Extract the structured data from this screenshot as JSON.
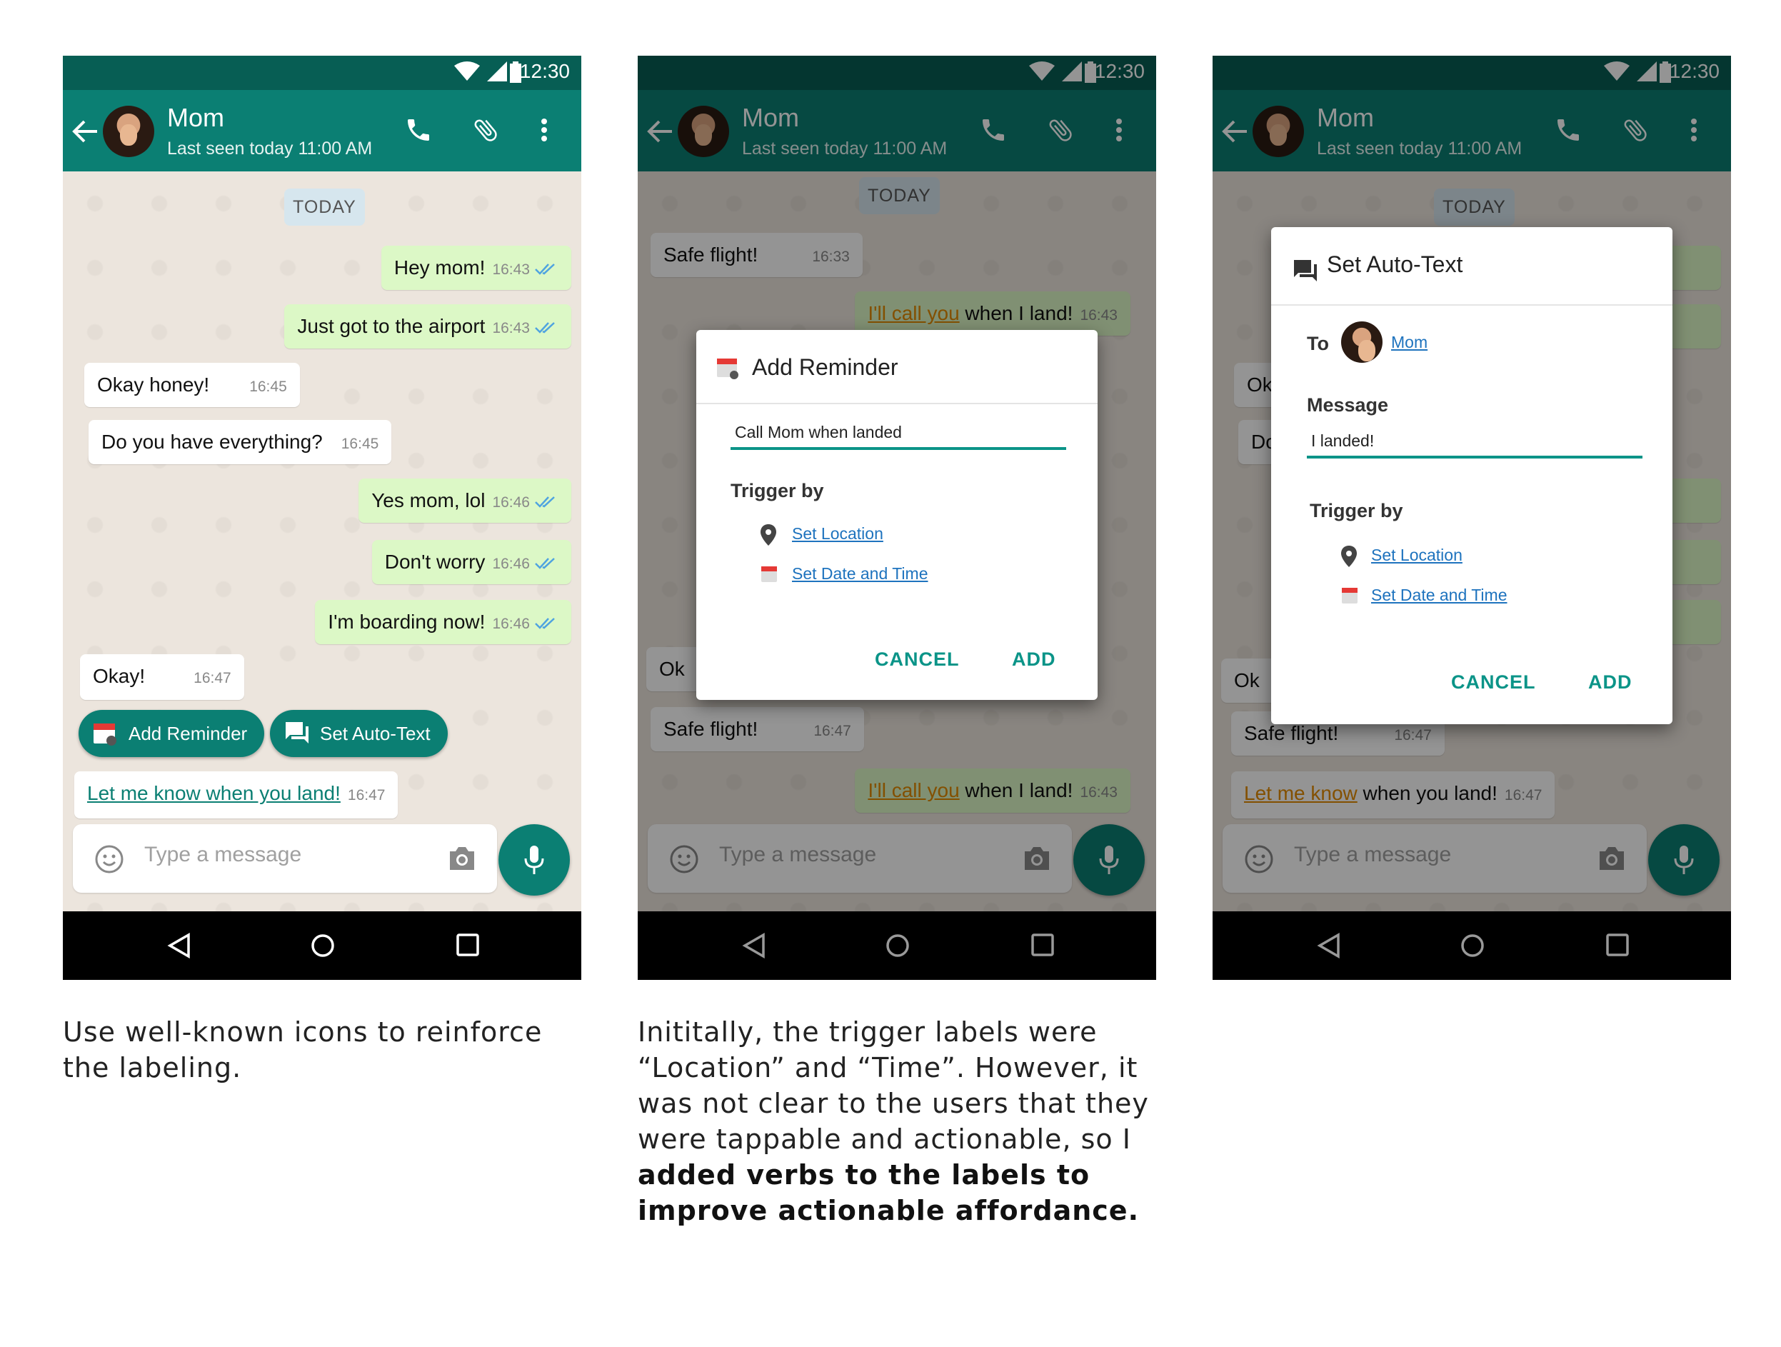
{
  "status": {
    "time": "12:30"
  },
  "header": {
    "name": "Mom",
    "last_seen": "Last seen today 11:00 AM",
    "icons": [
      "back-arrow-icon",
      "phone-icon",
      "attach-icon",
      "more-vert-icon"
    ]
  },
  "date_label": "TODAY",
  "messages": [
    {
      "text": "Hey mom!",
      "time": "16:43",
      "dir": "out"
    },
    {
      "text": "Just got to the airport",
      "time": "16:43",
      "dir": "out"
    },
    {
      "text": "Okay honey!",
      "time": "16:45",
      "dir": "in"
    },
    {
      "text": "Do you have everything?",
      "time": "16:45",
      "dir": "in"
    },
    {
      "text": "Yes mom, lol",
      "time": "16:46",
      "dir": "out"
    },
    {
      "text": "Don't worry",
      "time": "16:46",
      "dir": "out"
    },
    {
      "text": "I'm boarding now!",
      "time": "16:46",
      "dir": "out"
    },
    {
      "text": "Okay!",
      "time": "16:47",
      "dir": "in"
    }
  ],
  "chips": {
    "reminder": "Add Reminder",
    "autotext": "Set Auto-Text"
  },
  "link_message": {
    "text": "Let me know when you land!",
    "time": "16:47"
  },
  "screen2": {
    "msg1": {
      "text": "Safe flight!",
      "time": "16:33"
    },
    "msg2": {
      "link": "I'll call you",
      "rest": " when I land!",
      "time": "16:43"
    },
    "partial": "Ok",
    "msg3": {
      "text": "Safe flight!",
      "time": "16:47"
    },
    "msg4": {
      "link": "I'll call you",
      "rest": " when I land!",
      "time": "16:43"
    }
  },
  "screen3": {
    "partial1": "Ok",
    "partial2": "Do",
    "partial3": "Ok",
    "msg_a": {
      "text": "Safe flight!",
      "time": "16:47"
    },
    "msg_b": {
      "link": "Let me know",
      "rest": " when you land!",
      "time": "16:47"
    }
  },
  "input": {
    "placeholder": "Type a message"
  },
  "reminder_dialog": {
    "title": "Add Reminder",
    "value": "Call Mom when landed",
    "trigger_label": "Trigger by",
    "location": "Set Location",
    "datetime": "Set Date and Time",
    "cancel": "CANCEL",
    "add": "ADD"
  },
  "autotext_dialog": {
    "title": "Set Auto-Text",
    "to_label": "To",
    "to_value": "Mom",
    "message_label": "Message",
    "message_value": "I landed!",
    "trigger_label": "Trigger by",
    "location": "Set Location",
    "datetime": "Set Date and Time",
    "cancel": "CANCEL",
    "add": "ADD"
  },
  "captions": {
    "left": [
      "Use well-known icons to reinforce",
      "the labeling."
    ],
    "middle": [
      "Inititally, the trigger labels were",
      "“Location” and “Time”. However, it",
      "was not clear to the users that they",
      "were tappable and actionable, so I"
    ],
    "middle_bold": [
      "added verbs to the labels to",
      "improve actionable affordance."
    ]
  },
  "colors": {
    "primary": "#0b7f73",
    "statusbar": "#075e54",
    "outgoing": "#dcf8c6",
    "accent": "#0b9488",
    "link": "#1e73be",
    "highlight": "#e28a00"
  }
}
